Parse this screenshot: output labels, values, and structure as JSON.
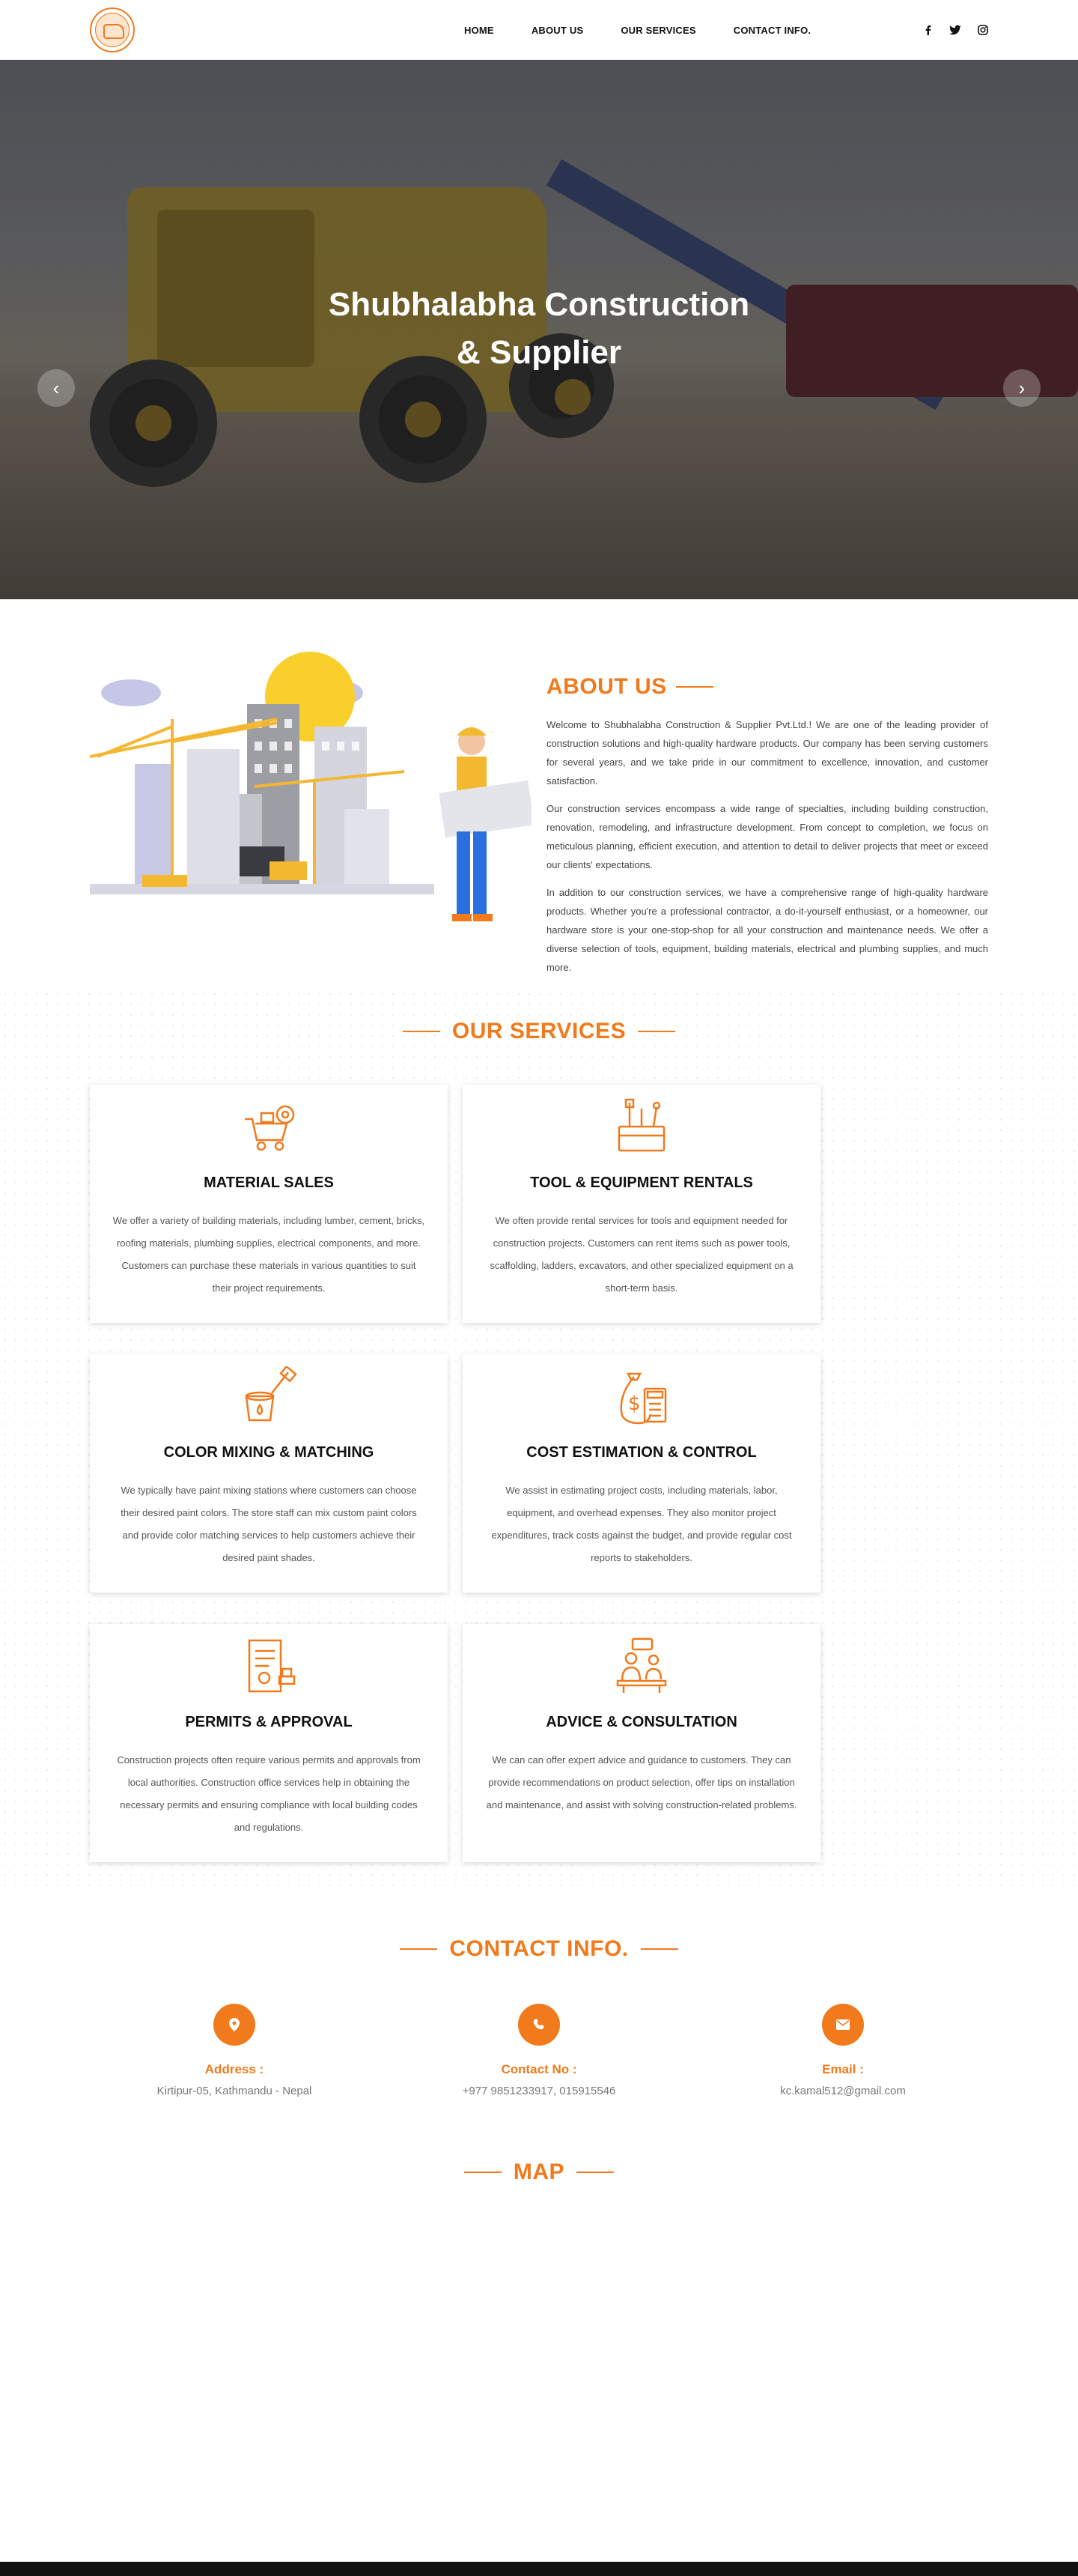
{
  "header": {
    "nav": [
      "HOME",
      "ABOUT US",
      "OUR SERVICES",
      "CONTACT INFO."
    ],
    "social_icons": [
      "facebook-icon",
      "twitter-icon",
      "instagram-icon"
    ]
  },
  "hero": {
    "title_line1": "Shubhalabha Construction",
    "title_line2": "& Supplier",
    "prev": "‹",
    "next": "›"
  },
  "about": {
    "title": "ABOUT US",
    "paragraphs": [
      "Welcome to Shubhalabha Construction & Supplier Pvt.Ltd.! We are one of the leading provider of construction solutions and high-quality hardware products. Our company has been serving customers for several years, and we take pride in our commitment to excellence, innovation, and customer satisfaction.",
      "Our construction services encompass a wide range of specialties, including building construction, renovation, remodeling, and infrastructure development. From concept to completion, we focus on meticulous planning, efficient execution, and attention to detail to deliver projects that meet or exceed our clients' expectations.",
      "In addition to our construction services, we have a comprehensive range of high-quality hardware products. Whether you're a professional contractor, a do-it-yourself enthusiast, or a homeowner, our hardware store is your one-stop-shop for all your construction and maintenance needs. We offer a diverse selection of tools, equipment, building materials, electrical and plumbing supplies, and much more."
    ]
  },
  "services": {
    "title": "OUR SERVICES",
    "items": [
      {
        "title": "MATERIAL SALES",
        "desc": "We offer a variety of building materials, including lumber, cement, bricks, roofing materials, plumbing supplies, electrical components, and more. Customers can purchase these materials in various quantities to suit their project requirements.",
        "icon": "material-cart-icon"
      },
      {
        "title": "TOOL & EQUIPMENT RENTALS",
        "desc": "We often provide rental services for tools and equipment needed for construction projects. Customers can rent items such as power tools, scaffolding, ladders, excavators, and other specialized equipment on a short-term basis.",
        "icon": "toolbox-icon"
      },
      {
        "title": "COLOR MIXING & MATCHING",
        "desc": "We typically have paint mixing stations where customers can choose their desired paint colors. The store staff can mix custom paint colors and provide color matching services to help customers achieve their desired paint shades.",
        "icon": "paint-bucket-icon"
      },
      {
        "title": "COST ESTIMATION & CONTROL",
        "desc": "We assist in estimating project costs, including materials, labor, equipment, and overhead expenses. They also monitor project expenditures, track costs against the budget, and provide regular cost reports to stakeholders.",
        "icon": "money-calculator-icon"
      },
      {
        "title": "PERMITS & APPROVAL",
        "desc": "Construction projects often require various permits and approvals from local authorities. Construction office services help in obtaining the necessary permits and ensuring compliance with local building codes and regulations.",
        "icon": "permit-document-icon"
      },
      {
        "title": "ADVICE & CONSULTATION",
        "desc": "We can can offer expert advice and guidance to customers. They can provide recommendations on product selection, offer tips on installation and maintenance, and assist with solving construction-related problems.",
        "icon": "consultation-icon"
      }
    ]
  },
  "contact": {
    "title": "CONTACT INFO.",
    "address_label": "Address :",
    "address_value": "Kirtipur-05, Kathmandu - Nepal",
    "phone_label": "Contact No :",
    "phone_value": "+977 9851233917, 015915546",
    "email_label": "Email :",
    "email_value": "kc.kamal512@gmail.com"
  },
  "map": {
    "title": "MAP"
  },
  "colors": {
    "accent": "#f07a1c",
    "text": "#444444"
  }
}
